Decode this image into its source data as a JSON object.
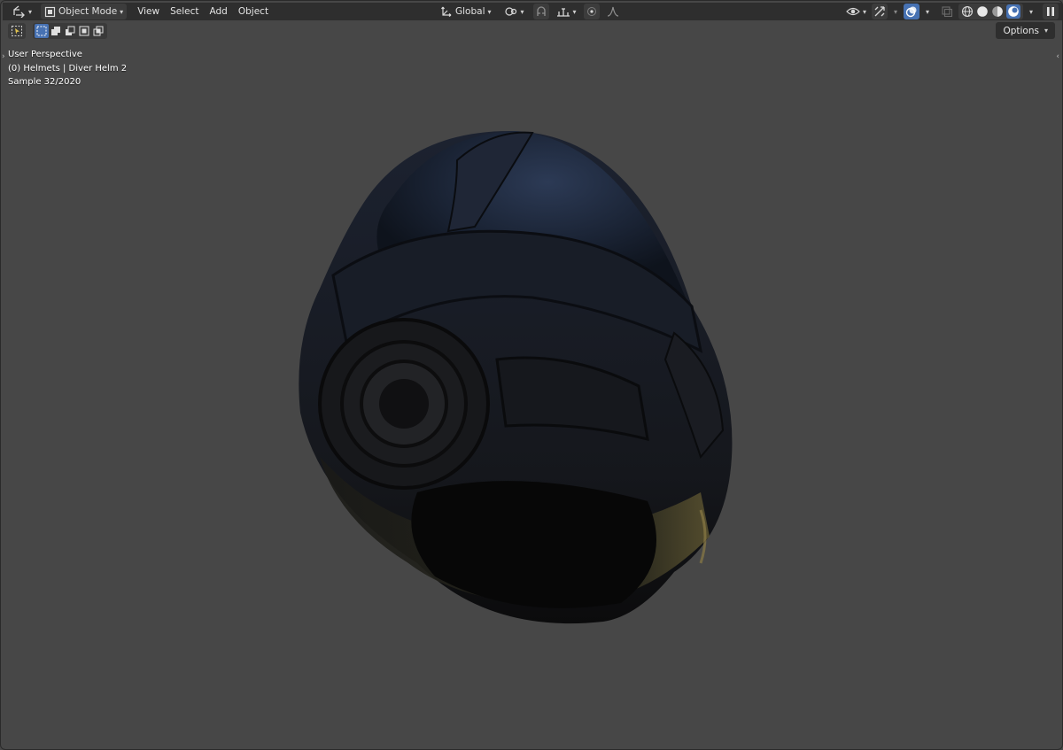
{
  "header": {
    "editor_type_icon": "object-transform-icon",
    "mode_label": "Object Mode",
    "menus": [
      "View",
      "Select",
      "Add",
      "Object"
    ],
    "transform_orientation": "Global",
    "icons_center": [
      "transform-orientation-icon",
      "pivot-point-icon",
      "snap-icon",
      "snap-target-icon",
      "proportional-editing-icon",
      "falloff-icon"
    ],
    "icons_right": [
      "visibility-icon",
      "gizmo-icon",
      "overlays-icon",
      "xray-icon",
      "shading-wireframe-icon",
      "shading-solid-icon",
      "shading-material-icon",
      "shading-rendered-icon",
      "pause-icon"
    ]
  },
  "toolrow": {
    "tool_icon": "select-tool-icon",
    "selection_modes": [
      "new-selection-icon",
      "extend-selection-icon",
      "subtract-selection-icon",
      "invert-selection-icon",
      "intersect-selection-icon"
    ]
  },
  "options_label": "Options",
  "overlay": {
    "line1": "User Perspective",
    "line2": "(0) Helmets | Diver Helm 2",
    "line3": "Sample 32/2020"
  },
  "colors": {
    "viewport_bg": "#474747",
    "header_bg": "#2e2e2e",
    "accent": "#4772b3"
  }
}
